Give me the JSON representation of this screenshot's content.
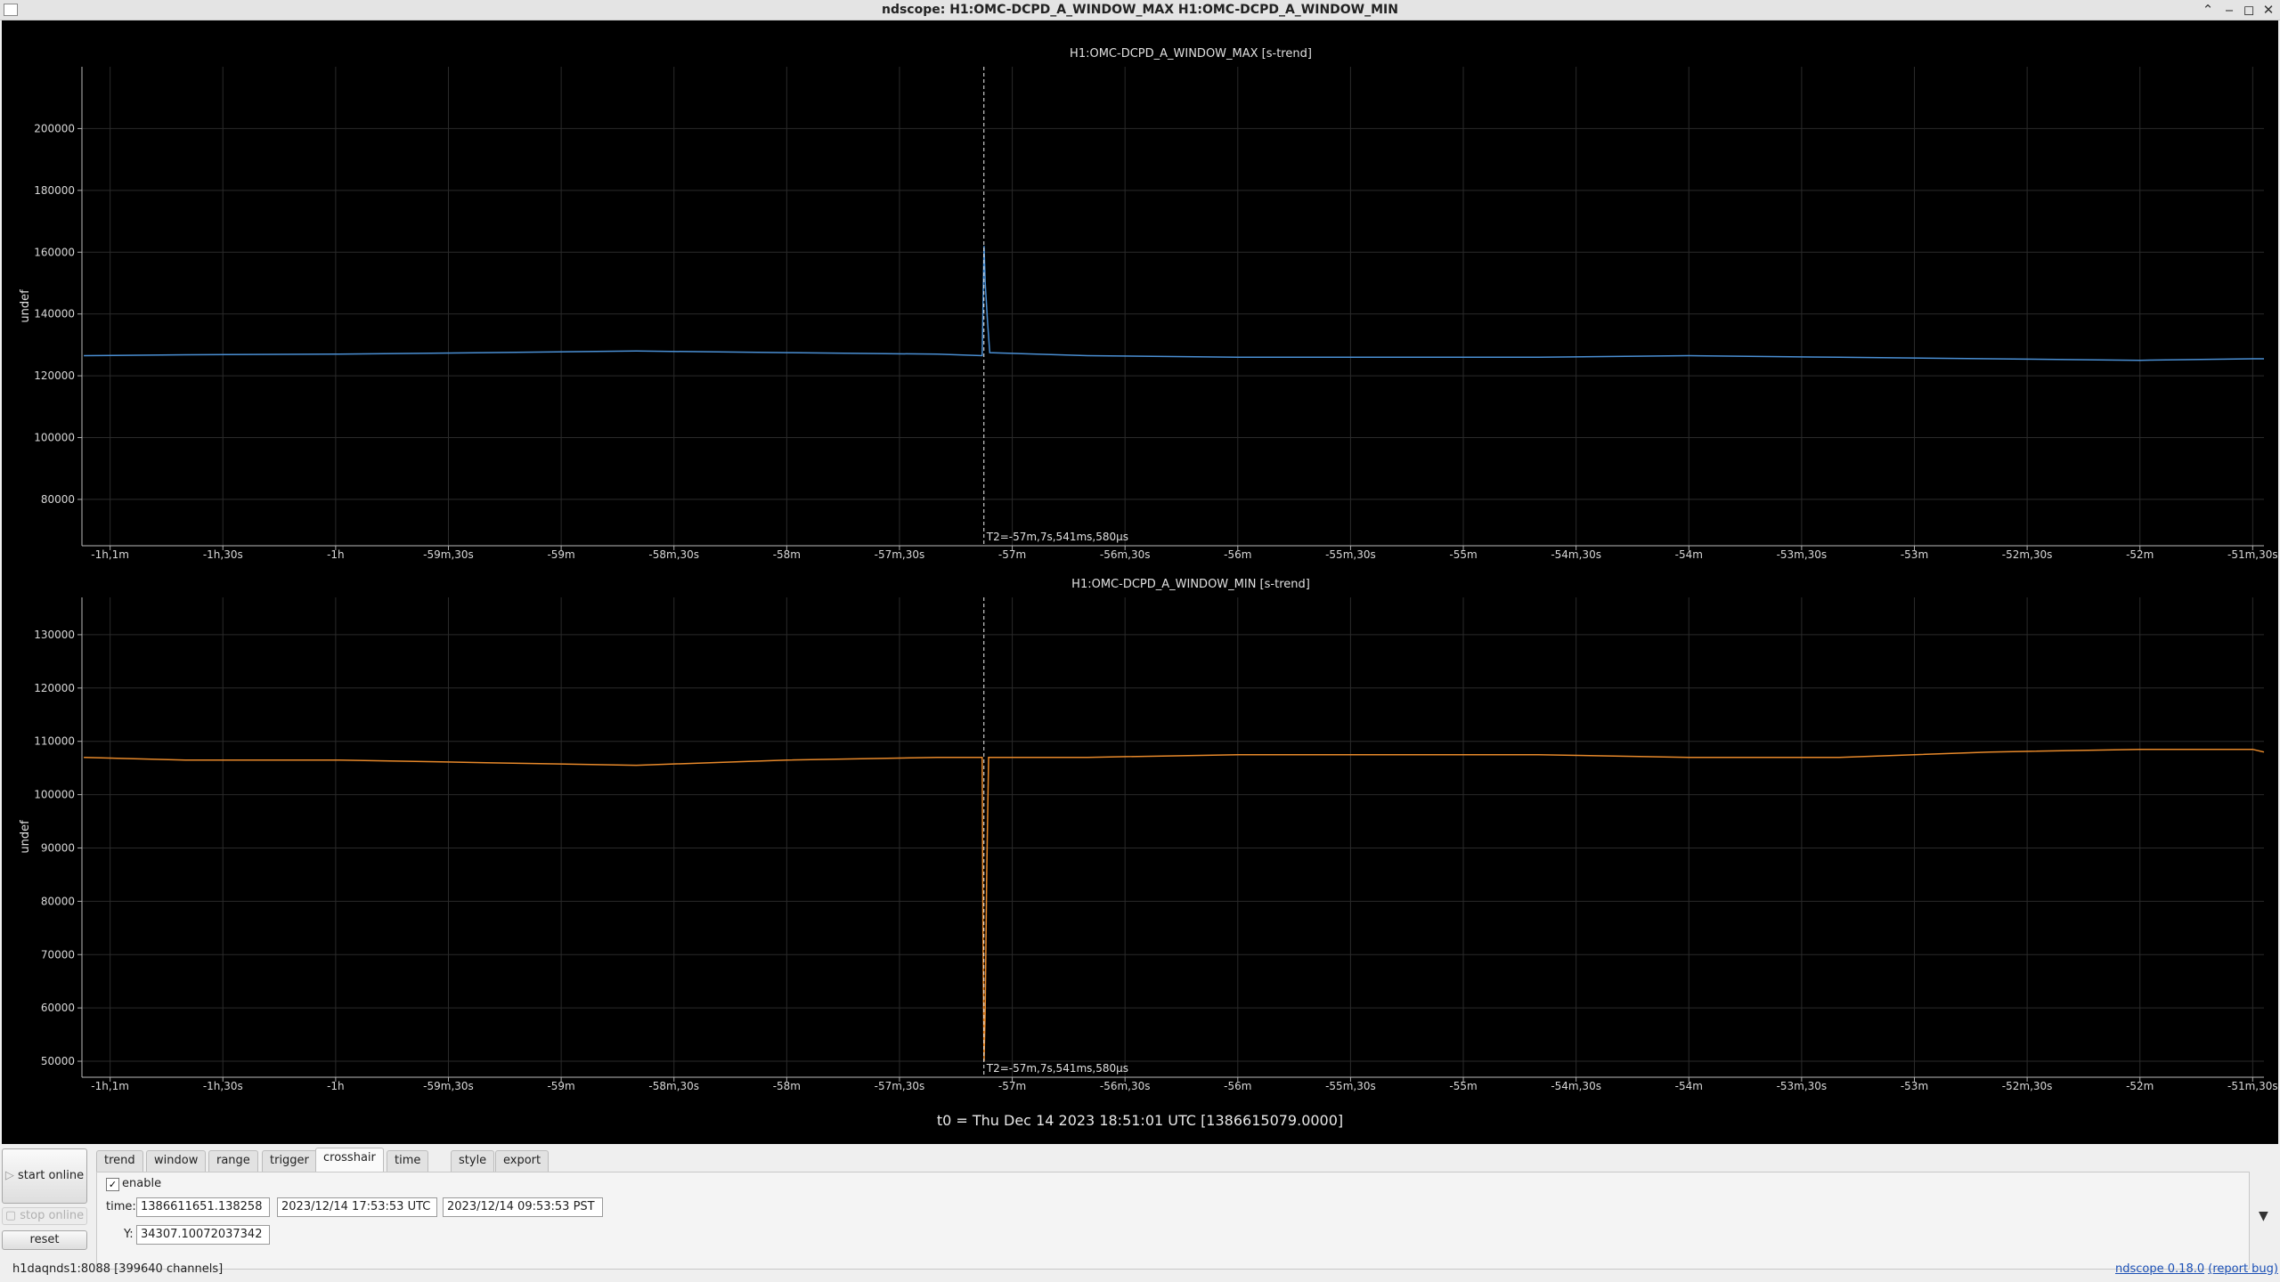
{
  "window": {
    "title": "ndscope: H1:OMC-DCPD_A_WINDOW_MAX H1:OMC-DCPD_A_WINDOW_MIN",
    "controls": [
      "minimize",
      "maximize",
      "restore",
      "close"
    ]
  },
  "t0_label": "t0 = Thu Dec 14 2023 18:51:01 UTC [1386615079.0000]",
  "chart_data": [
    {
      "type": "line",
      "title": "H1:OMC-DCPD_A_WINDOW_MAX [s-trend]",
      "ylabel": "undef",
      "x_ticks": [
        "-1h,1m",
        "-1h,30s",
        "-1h",
        "-59m,30s",
        "-59m",
        "-58m,30s",
        "-58m",
        "-57m,30s",
        "-57m",
        "-56m,30s",
        "-56m",
        "-55m,30s",
        "-55m",
        "-54m,30s",
        "-54m",
        "-53m,30s",
        "-53m",
        "-52m,30s",
        "-52m",
        "-51m,30s"
      ],
      "x_tick_seconds": [
        -3660,
        -3630,
        -3600,
        -3570,
        -3540,
        -3510,
        -3480,
        -3450,
        -3420,
        -3390,
        -3360,
        -3330,
        -3300,
        -3270,
        -3240,
        -3210,
        -3180,
        -3150,
        -3120,
        -3090
      ],
      "xlim_seconds": [
        -3667.5,
        -3087
      ],
      "y_ticks": [
        80000,
        100000,
        120000,
        140000,
        160000,
        180000,
        200000
      ],
      "ylim": [
        65000,
        220000
      ],
      "grid": true,
      "color": "#4a8fd4",
      "series": [
        {
          "x_seconds": [
            -3667,
            -3640,
            -3600,
            -3560,
            -3520,
            -3480,
            -3440,
            -3428,
            -3427.5,
            -3427.2,
            -3426.6,
            -3426,
            -3400,
            -3360,
            -3320,
            -3280,
            -3240,
            -3200,
            -3160,
            -3120,
            -3090,
            -3087
          ],
          "values": [
            126500,
            126800,
            127000,
            127500,
            128000,
            127500,
            127000,
            126500,
            162000,
            150000,
            138000,
            127500,
            126500,
            126000,
            126000,
            126000,
            126500,
            126000,
            125500,
            125000,
            125500,
            125500
          ]
        }
      ],
      "crosshair": {
        "x_seconds": -3427.54158,
        "label": "T2=-57m,7s,541ms,580μs"
      }
    },
    {
      "type": "line",
      "title": "H1:OMC-DCPD_A_WINDOW_MIN [s-trend]",
      "ylabel": "undef",
      "x_ticks": [
        "-1h,1m",
        "-1h,30s",
        "-1h",
        "-59m,30s",
        "-59m",
        "-58m,30s",
        "-58m",
        "-57m,30s",
        "-57m",
        "-56m,30s",
        "-56m",
        "-55m,30s",
        "-55m",
        "-54m,30s",
        "-54m",
        "-53m,30s",
        "-53m",
        "-52m,30s",
        "-52m",
        "-51m,30s"
      ],
      "x_tick_seconds": [
        -3660,
        -3630,
        -3600,
        -3570,
        -3540,
        -3510,
        -3480,
        -3450,
        -3420,
        -3390,
        -3360,
        -3330,
        -3300,
        -3270,
        -3240,
        -3210,
        -3180,
        -3150,
        -3120,
        -3090
      ],
      "xlim_seconds": [
        -3667.5,
        -3087
      ],
      "y_ticks": [
        50000,
        60000,
        70000,
        80000,
        90000,
        100000,
        110000,
        120000,
        130000
      ],
      "ylim": [
        47000,
        137000
      ],
      "grid": true,
      "color": "#e8892a",
      "series": [
        {
          "x_seconds": [
            -3667,
            -3640,
            -3600,
            -3560,
            -3520,
            -3480,
            -3440,
            -3428,
            -3427.8,
            -3427.5,
            -3427.2,
            -3426.8,
            -3426.3,
            -3400,
            -3360,
            -3320,
            -3280,
            -3240,
            -3200,
            -3160,
            -3120,
            -3090,
            -3087
          ],
          "values": [
            107000,
            106500,
            106500,
            106000,
            105500,
            106500,
            107000,
            107000,
            74000,
            50000,
            60000,
            85000,
            107000,
            107000,
            107500,
            107500,
            107500,
            107000,
            107000,
            108000,
            108500,
            108500,
            108000
          ]
        }
      ],
      "crosshair": {
        "x_seconds": -3427.54158,
        "label": "T2=-57m,7s,541ms,580μs"
      }
    }
  ],
  "controls": {
    "start_online": "start online",
    "stop_online": "stop online",
    "reset": "reset"
  },
  "tabs": [
    "trend",
    "window",
    "range",
    "trigger",
    "crosshair",
    "time axis",
    "style",
    "export"
  ],
  "active_tab": "crosshair",
  "crosshair_panel": {
    "enable_label": "enable",
    "enabled": true,
    "time_label": "time:",
    "time_gps": "1386611651.138258",
    "time_utc": "2023/12/14 17:53:53 UTC",
    "time_pst": "2023/12/14 09:53:53 PST",
    "y_label": "Y:",
    "y_value": "34307.10072037342"
  },
  "status": {
    "server": "h1daqnds1:8088  [399640 channels]",
    "version": "ndscope 0.18.0",
    "report": "(report bug)"
  }
}
